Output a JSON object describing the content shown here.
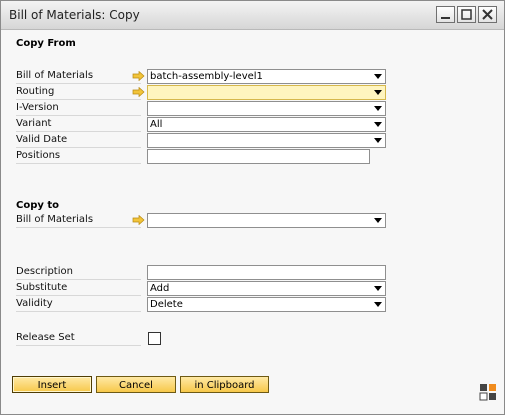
{
  "window": {
    "title": "Bill of Materials: Copy"
  },
  "copy_from": {
    "heading": "Copy From",
    "fields": {
      "bom": {
        "label": "Bill of Materials",
        "value": "batch-assembly-level1"
      },
      "routing": {
        "label": "Routing",
        "value": ""
      },
      "iversion": {
        "label": "I-Version",
        "value": ""
      },
      "variant": {
        "label": "Variant",
        "value": "All"
      },
      "valid_date": {
        "label": "Valid Date",
        "value": ""
      },
      "positions": {
        "label": "Positions",
        "value": ""
      }
    }
  },
  "copy_to": {
    "heading": "Copy to",
    "fields": {
      "bom": {
        "label": "Bill of Materials",
        "value": ""
      },
      "description": {
        "label": "Description",
        "value": ""
      },
      "substitute": {
        "label": "Substitute",
        "value": "Add"
      },
      "validity": {
        "label": "Validity",
        "value": "Delete"
      },
      "release_set": {
        "label": "Release Set",
        "checked": false
      }
    }
  },
  "buttons": {
    "insert": "Insert",
    "cancel": "Cancel",
    "clipboard": "in Clipboard"
  },
  "colors": {
    "button_fill": "#f7c84a",
    "highlight_field": "#fff5bf",
    "link_arrow": "#f2c43a"
  }
}
